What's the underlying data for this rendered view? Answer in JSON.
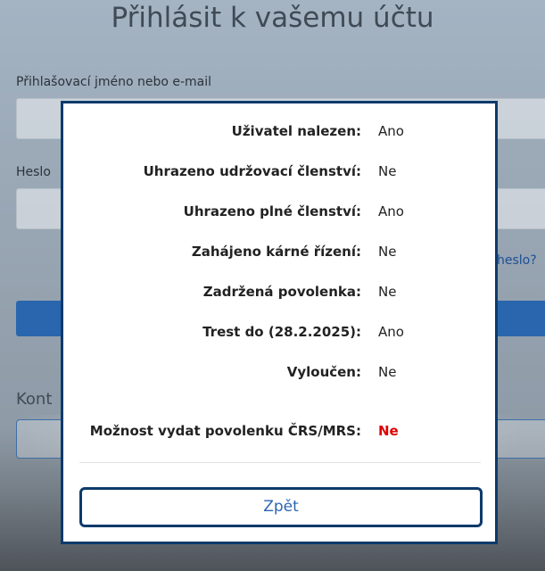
{
  "login": {
    "title": "Přihlásit k vašemu účtu",
    "username_label": "Přihlašovací jméno nebo e-mail",
    "password_label": "Heslo",
    "forgot_fragment": "heslo?",
    "contact_fragment": "Kont"
  },
  "modal": {
    "rows": [
      {
        "label": "Uživatel nalezen:",
        "value": "Ano"
      },
      {
        "label": "Uhrazeno udržovací členství:",
        "value": "Ne"
      },
      {
        "label": "Uhrazeno plné členství:",
        "value": "Ano"
      },
      {
        "label": "Zahájeno kárné řízení:",
        "value": "Ne"
      },
      {
        "label": "Zadržená povolenka:",
        "value": "Ne"
      },
      {
        "label": "Trest do (28.2.2025):",
        "value": "Ano"
      },
      {
        "label": "Vyloučen:",
        "value": "Ne"
      }
    ],
    "result": {
      "label": "Možnost vydat povolenku ČRS/MRS:",
      "value": "Ne"
    },
    "back_label": "Zpět"
  },
  "colors": {
    "modal_border": "#0e3a6b",
    "negative_result": "#e00000",
    "primary_button": "#2966ad"
  }
}
